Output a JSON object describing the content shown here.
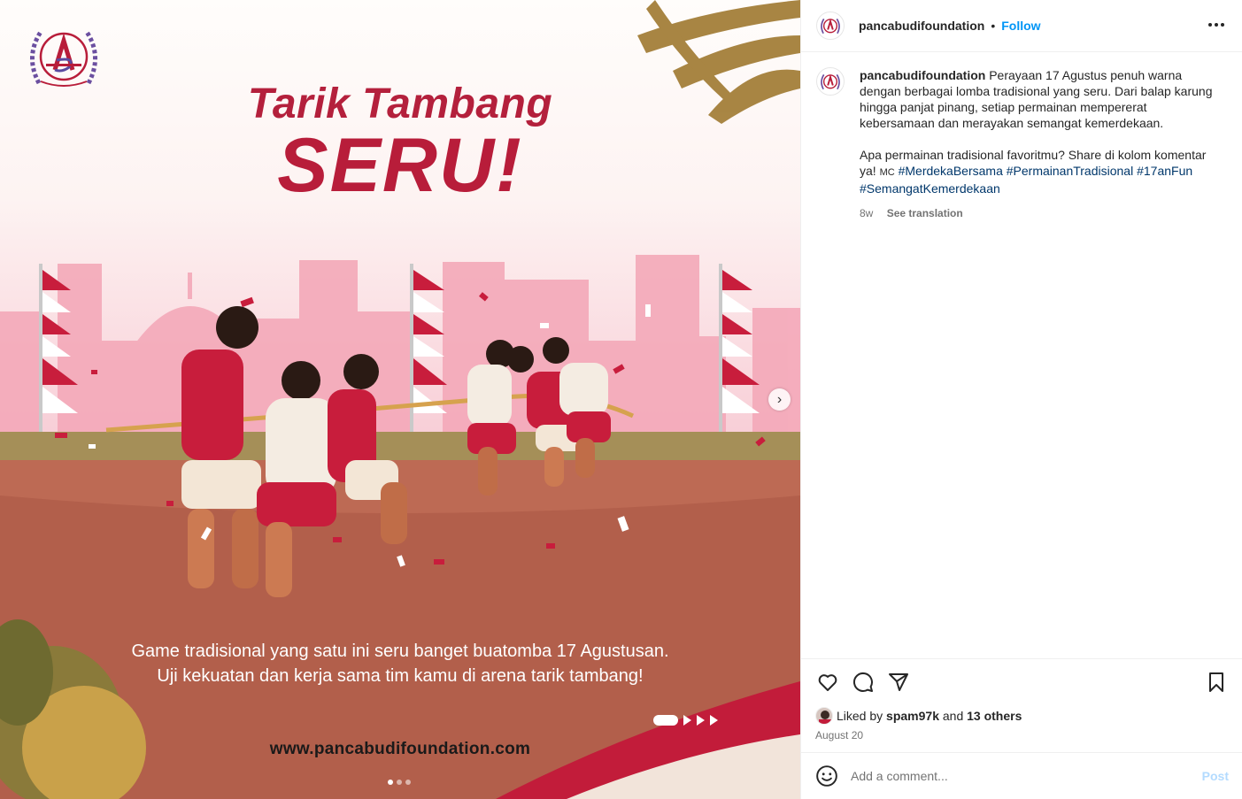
{
  "post": {
    "title_line1": "Tarik Tambang",
    "title_line2": "SERU!",
    "caption_line1": "Game tradisional yang satu ini seru banget buatomba 17 Agustusan.",
    "caption_line2": "Uji kekuatan dan kerja sama tim kamu di arena tarik tambang!",
    "website": "www.pancabudifoundation.com",
    "slide_count": 3,
    "active_slide": 1
  },
  "header": {
    "username": "pancabudifoundation",
    "dot": "•",
    "follow": "Follow",
    "more_icon": "more-horizontal-icon"
  },
  "caption": {
    "username": "pancabudifoundation",
    "text_p1": "Perayaan 17 Agustus penuh warna dengan berbagai lomba tradisional yang seru. Dari balap karung hingga panjat pinang, setiap permainan mempererat kebersamaan dan merayakan semangat kemerdekaan.",
    "text_p2": "Apa permainan tradisional favoritmu? Share di kolom komentar ya!",
    "mc": "MC",
    "hashtags": [
      "#MerdekaBersama",
      "#PermainanTradisional",
      "#17anFun",
      "#SemangatKemerdekaan"
    ],
    "time": "8w",
    "see_translation": "See translation"
  },
  "actions": {
    "liked_by_prefix": "Liked by",
    "liked_by_user": "spam97k",
    "liked_by_and": "and",
    "liked_by_others": "13 others",
    "date": "August 20"
  },
  "comment_box": {
    "placeholder": "Add a comment...",
    "post": "Post"
  },
  "colors": {
    "accent_red": "#b81d3a",
    "link_blue": "#0095f6",
    "hashtag": "#00376b"
  }
}
